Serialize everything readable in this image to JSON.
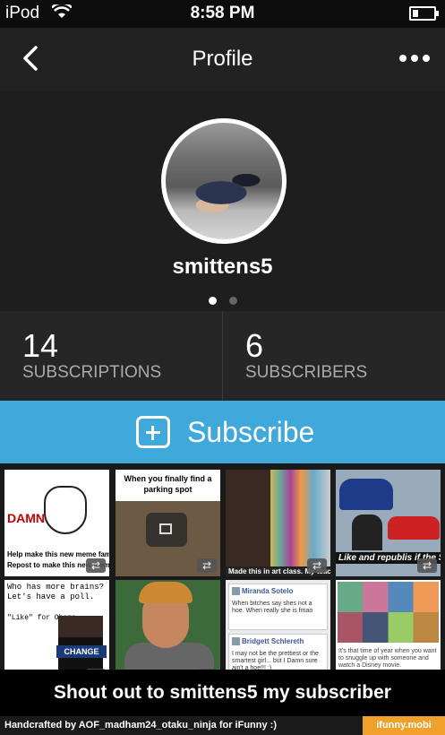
{
  "status_bar": {
    "carrier": "iPod",
    "time": "8:58 PM"
  },
  "nav": {
    "title": "Profile",
    "back_icon": "chevron-left-icon",
    "more_icon": "ellipsis-icon"
  },
  "profile": {
    "username": "smittens5",
    "page_dots": {
      "total": 2,
      "active": 1
    }
  },
  "stats": {
    "subscriptions": {
      "count": "14",
      "label": "SUBSCRIPTIONS"
    },
    "subscribers": {
      "count": "6",
      "label": "SUBSCRIBERS"
    }
  },
  "subscribe_button": {
    "label": "Subscribe",
    "color": "#3fa9dc"
  },
  "grid": {
    "tile1": {
      "word": "DAMN",
      "caption1": "Help make this new meme fam",
      "caption2": "Repost to make this new meme fam"
    },
    "tile2": {
      "title": "When you finally find a parking spot"
    },
    "tile3": {
      "caption": "Made this in art class. My teacher put it in our school's art sho"
    },
    "tile4": {
      "caption": "Like and republis if the Shelby Cob"
    },
    "tile5": {
      "line1": "Who has more brains? Let's have a poll.",
      "line2": "\"Like\" for Obama",
      "badge": "CHANGE"
    },
    "tile7": {
      "post1_name": "Miranda Sotelo",
      "post1_text": "When bitches say shes not a hoe. When really she is fmao",
      "post2_name": "Bridgett Schlereth",
      "post2_text": "I may not be the prettiest or the smartest girl... but I Damn sure ain't a hoe!!! :)"
    },
    "tile8": {
      "text": "It's that time of year when you want to snuggle up with someone and watch a Disney movie."
    }
  },
  "banner": {
    "text": "Shout out to smittens5 my subscriber"
  },
  "footer": {
    "credit": "Handcrafted by AOF_madham24_otaku_ninja for iFunny :)",
    "brand": "ifunny.mobi",
    "brand_color": "#f0a12b"
  }
}
